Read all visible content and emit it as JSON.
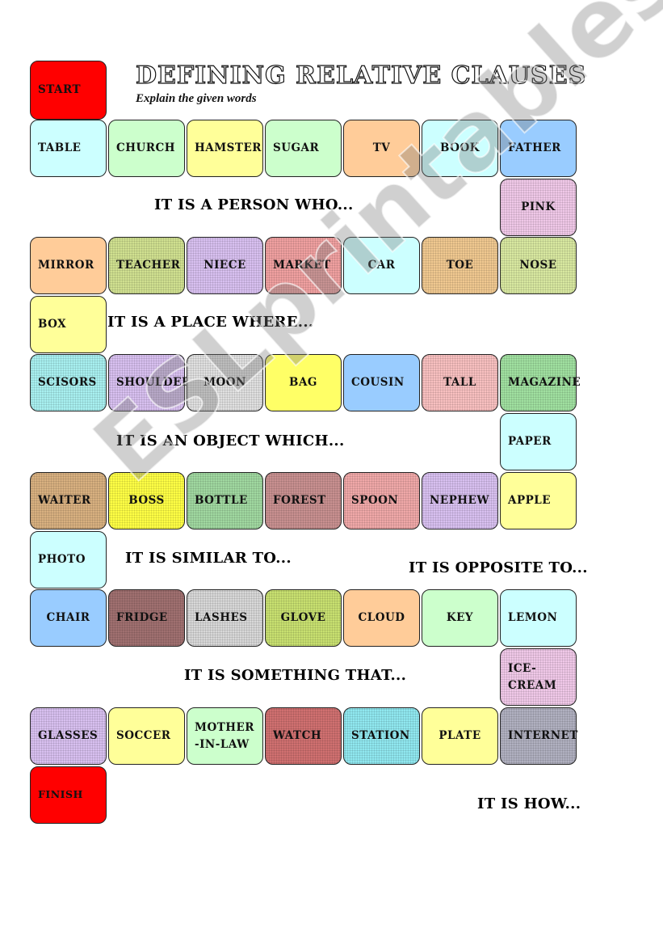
{
  "header": {
    "title": "DEFINING RELATIVE CLAUSES",
    "subtitle": "Explain the given words"
  },
  "squares": [
    {
      "label": "START",
      "color": "#ff0000",
      "type": "start"
    },
    {
      "label": "TABLE",
      "color": "#ccffff"
    },
    {
      "label": "CHURCH",
      "color": "#ccffcc"
    },
    {
      "label": "HAMSTER",
      "color": "#ffff99"
    },
    {
      "label": "SUGAR",
      "color": "#ccffcc"
    },
    {
      "label": "TV",
      "color": "#ffcc99"
    },
    {
      "label": "BOOK",
      "color": "#ccffff"
    },
    {
      "label": "FATHER",
      "color": "#99ccff"
    },
    {
      "label": "PINK",
      "color": "#f0c8e8",
      "pattern": true
    },
    {
      "label": "NOSE",
      "color": "#d8e8a0",
      "pattern": true
    },
    {
      "label": "TOE",
      "color": "#f0c890",
      "pattern": true
    },
    {
      "label": "CAR",
      "color": "#ccffff"
    },
    {
      "label": "MARKET",
      "color": "#f0a0a0",
      "pattern": true
    },
    {
      "label": "NIECE",
      "color": "#d8c0f0",
      "pattern": true
    },
    {
      "label": "TEACHER",
      "color": "#d0e090",
      "pattern": true
    },
    {
      "label": "MIRROR",
      "color": "#ffcc99"
    },
    {
      "label": "BOX",
      "color": "#ffff99"
    },
    {
      "label": "SCISORS",
      "color": "#a8f0f0",
      "pattern": true
    },
    {
      "label": "SHOULDER",
      "color": "#d8c0f0",
      "pattern": true
    },
    {
      "label": "MOON",
      "color": "#e0e0e0",
      "pattern": true
    },
    {
      "label": "BAG",
      "color": "#ffff66"
    },
    {
      "label": "COUSIN",
      "color": "#99ccff"
    },
    {
      "label": "TALL",
      "color": "#f8c0c0",
      "pattern": true
    },
    {
      "label": "MAGAZINE",
      "color": "#a0e0a0",
      "pattern": true
    },
    {
      "label": "PAPER",
      "color": "#ccffff"
    },
    {
      "label": "APPLE",
      "color": "#ffff99"
    },
    {
      "label": "NEPHEW",
      "color": "#d8c0f0",
      "pattern": true
    },
    {
      "label": "SPOON",
      "color": "#f0a8a8",
      "pattern": true
    },
    {
      "label": "FOREST",
      "color": "#c89090",
      "pattern": true
    },
    {
      "label": "BOTTLE",
      "color": "#a0d8a0",
      "pattern": true
    },
    {
      "label": "BOSS",
      "color": "#ffff44",
      "pattern": true
    },
    {
      "label": "WAITER",
      "color": "#d8b080",
      "pattern": true
    },
    {
      "label": "PHOTO",
      "color": "#ccffff"
    },
    {
      "label": "CHAIR",
      "color": "#99ccff"
    },
    {
      "label": "FRIDGE",
      "color": "#a07070",
      "pattern": true
    },
    {
      "label": "LASHES",
      "color": "#d8d8d8",
      "pattern": true
    },
    {
      "label": "GLOVE",
      "color": "#c8e070",
      "pattern": true
    },
    {
      "label": "CLOUD",
      "color": "#ffcc99"
    },
    {
      "label": "KEY",
      "color": "#ccffcc"
    },
    {
      "label": "LEMON",
      "color": "#ccffff"
    },
    {
      "label": "ICE-\nCREAM",
      "color": "#f0c8e8",
      "pattern": true
    },
    {
      "label": "INTERNET",
      "color": "#b0b0c0",
      "pattern": true
    },
    {
      "label": "PLATE",
      "color": "#ffff99"
    },
    {
      "label": "STATION",
      "color": "#90e8f0",
      "pattern": true
    },
    {
      "label": "WATCH",
      "color": "#d07070",
      "pattern": true
    },
    {
      "label": "MOTHER\n-IN-LAW",
      "color": "#ccffcc"
    },
    {
      "label": "SOCCER",
      "color": "#ffff99"
    },
    {
      "label": "GLASSES",
      "color": "#d8c0f0",
      "pattern": true
    },
    {
      "label": "FINISH",
      "color": "#ff0000",
      "type": "finish"
    }
  ],
  "clues": [
    {
      "text": "IT IS A PERSON WHO...",
      "color": "#a01040"
    },
    {
      "text": "IT IS A PLACE WHERE...",
      "color": "#1a8a1a"
    },
    {
      "text": "IT IS AN OBJECT WHICH...",
      "color": "#1a1ac8"
    },
    {
      "text": "IT IS SIMILAR TO...",
      "color": "#c84010"
    },
    {
      "text": "IT IS OPPOSITE TO...",
      "color": "#902090"
    },
    {
      "text": "IT IS SOMETHING THAT...",
      "color": "#801880"
    },
    {
      "text": "IT IS HOW...",
      "color": "#901818"
    }
  ],
  "watermark": "ESLprintables.com"
}
